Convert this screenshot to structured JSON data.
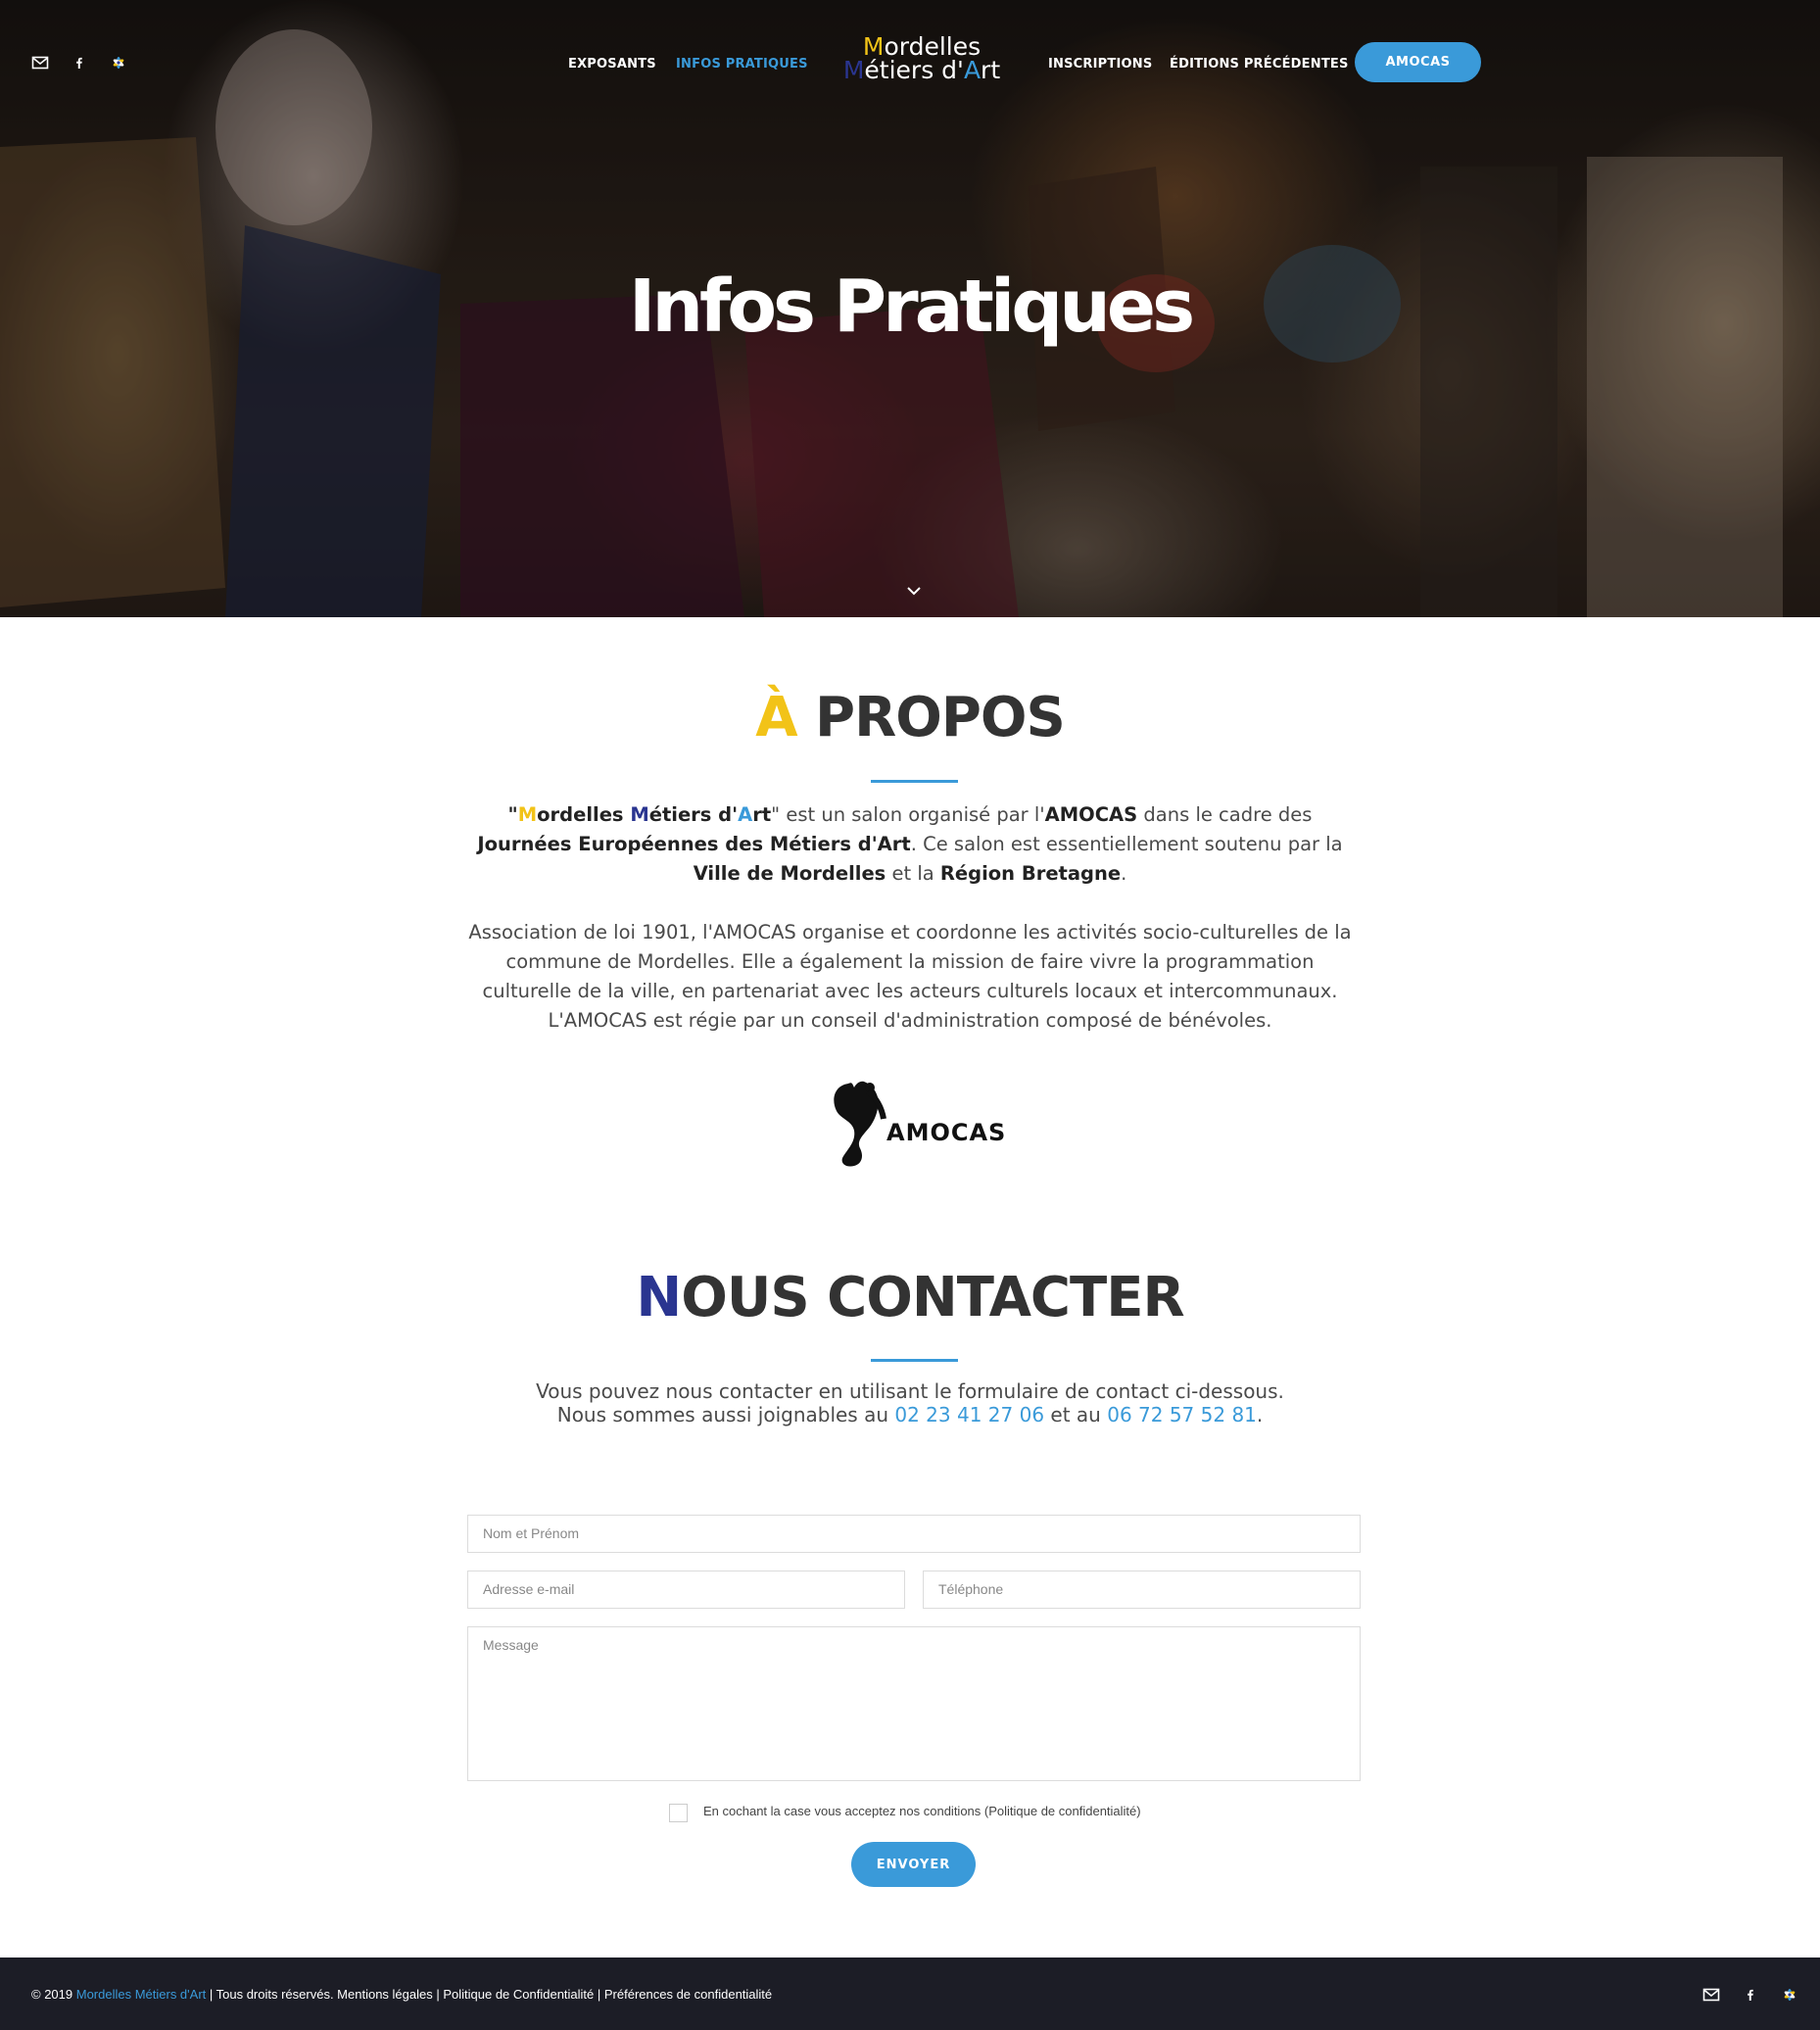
{
  "header": {
    "logo": {
      "m1": "M",
      "line1_rest": "ordelles",
      "m2": "M",
      "line2_mid": "étiers d'",
      "a": "A",
      "line2_end": "rt"
    },
    "nav": [
      {
        "label": "EXPOSANTS"
      },
      {
        "label": "INFOS PRATIQUES",
        "active": true
      },
      {
        "label": "INSCRIPTIONS"
      },
      {
        "label": "ÉDITIONS PRÉCÉDENTES"
      }
    ],
    "cta": "AMOCAS",
    "icons": [
      "mail-icon",
      "facebook-icon",
      "flower-icon"
    ]
  },
  "hero": {
    "title": "Infos Pratiques"
  },
  "about": {
    "title_accent": "À",
    "title_rest": " PROPOS",
    "p1": {
      "q1": "\"",
      "m1": "M",
      "ordelles": "ordelles ",
      "m2": "M",
      "etiers": "étiers d'",
      "a": "A",
      "rt": "rt",
      "q2": "\"",
      "t1": " est un salon organisé par l'",
      "amocas": "AMOCAS",
      "t2": " dans le cadre des ",
      "jema": "Journées Européennes des Métiers d'Art",
      "t3": ". Ce salon est essentiellement soutenu par la ",
      "ville": "Ville de Mordelles",
      "t4": " et la ",
      "region": "Région Bretagne",
      "t5": "."
    },
    "p2": "Association de loi 1901, l'AMOCAS organise et coordonne les activités socio-culturelles de la commune de Mordelles. Elle a également la mission de faire vivre la programmation culturelle de la ville, en partenariat avec les acteurs culturels locaux et intercommunaux. L'AMOCAS est régie par un conseil d'administration composé de bénévoles.",
    "logo_text": "AMOCAS"
  },
  "contact": {
    "title_accent": "N",
    "title_rest": "OUS CONTACTER",
    "line1": "Vous pouvez nous contacter en utilisant le formulaire de contact ci-dessous.",
    "line2_a": "Nous sommes aussi joignables au ",
    "phone1": "02 23 41 27 06",
    "line2_b": " et au ",
    "phone2": "06 72 57 52 81",
    "line2_c": "."
  },
  "form": {
    "name_placeholder": "Nom et Prénom",
    "email_placeholder": "Adresse e-mail",
    "phone_placeholder": "Téléphone",
    "message_placeholder": "Message",
    "consent": "En cochant la case vous acceptez nos conditions (Politique de confidentialité)",
    "submit": "ENVOYER"
  },
  "footer": {
    "copy": "© 2019 ",
    "brand": "Mordelles Métiers d'Art",
    "rest": " | Tous droits réservés. Mentions légales | Politique de Confidentialité | Préférences de confidentialité"
  },
  "colors": {
    "accent": "#3a9ad9",
    "yellow": "#f2c318",
    "navy": "#2a3590",
    "footer": "#1c1d26"
  }
}
